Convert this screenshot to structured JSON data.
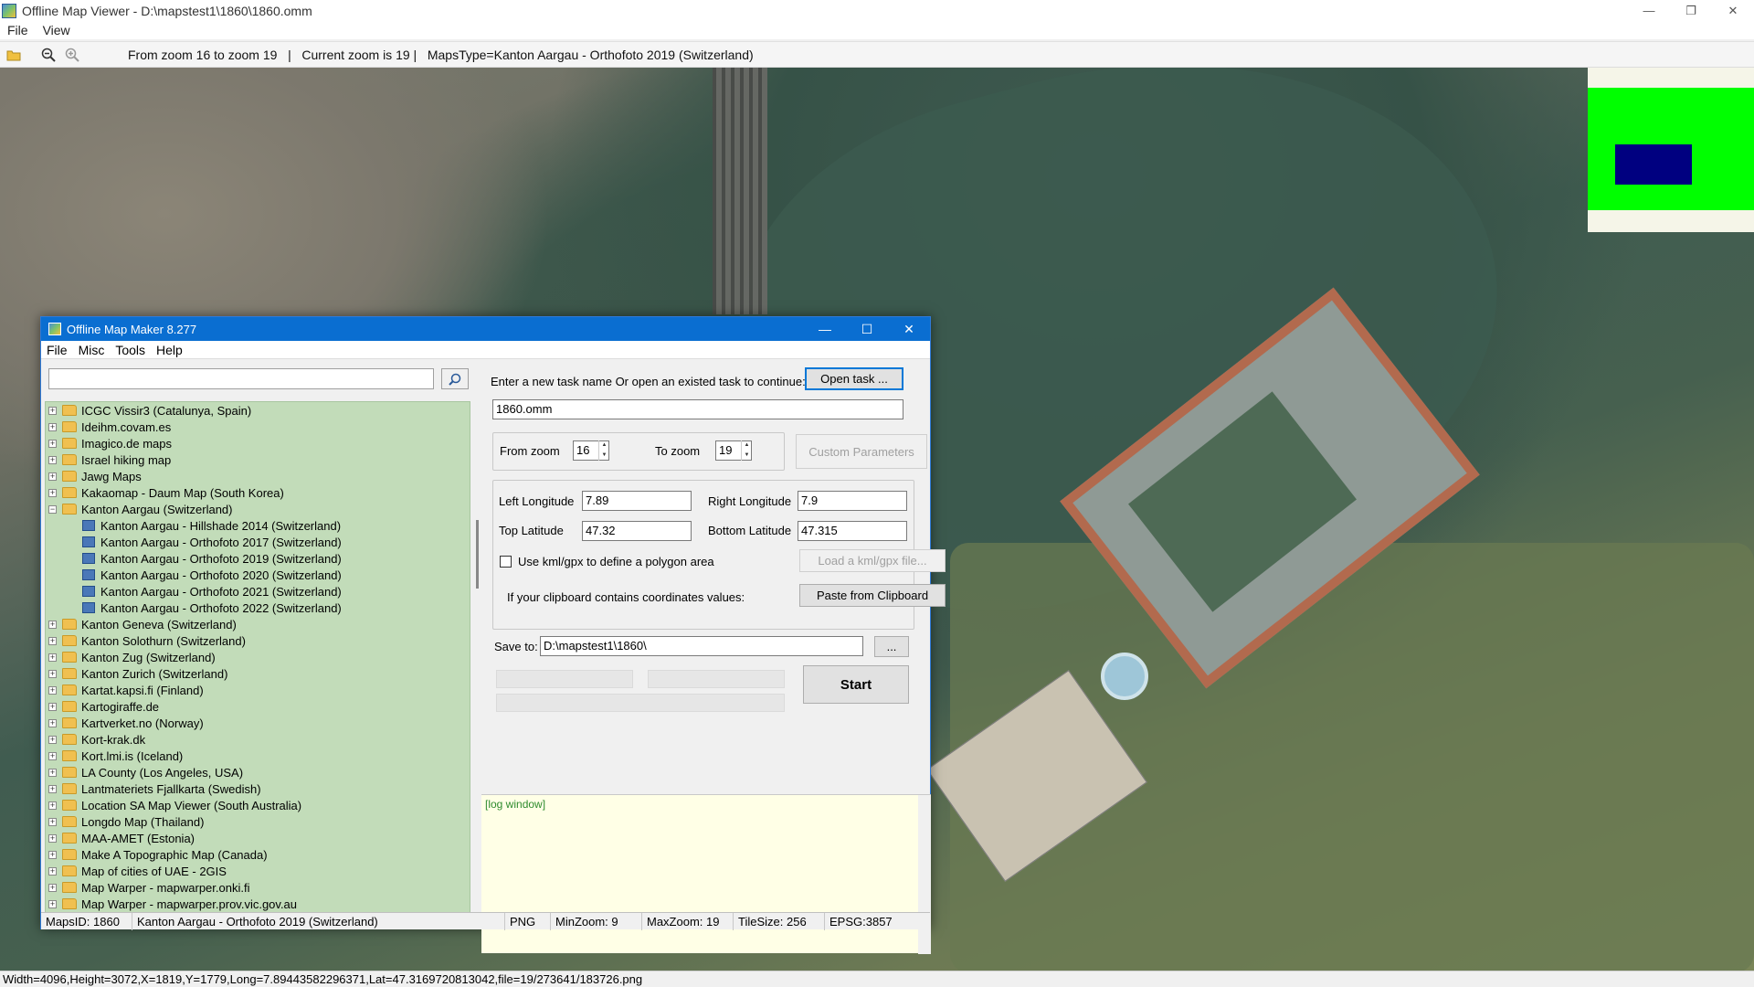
{
  "outer": {
    "title": "Offline Map Viewer - D:\\mapstest1\\1860\\1860.omm",
    "menu": [
      "File",
      "View"
    ],
    "status_info": "From zoom 16 to zoom 19   |   Current zoom is 19 |   MapsType=Kanton Aargau - Orthofoto 2019 (Switzerland)",
    "bottom_status": "Width=4096,Height=3072,X=1819,Y=1779,Long=7.89443582296371,Lat=47.3169720813042,file=19/273641/183726.png"
  },
  "dialog": {
    "title": "Offline Map Maker 8.277",
    "menu": [
      "File",
      "Misc",
      "Tools",
      "Help"
    ],
    "search_value": "",
    "tree": [
      {
        "label": "ICGC Vissir3 (Catalunya, Spain)",
        "type": "folder"
      },
      {
        "label": "Ideihm.covam.es",
        "type": "folder"
      },
      {
        "label": "Imagico.de maps",
        "type": "folder"
      },
      {
        "label": "Israel hiking map",
        "type": "folder"
      },
      {
        "label": "Jawg Maps",
        "type": "folder"
      },
      {
        "label": "Kakaomap - Daum Map (South Korea)",
        "type": "folder"
      },
      {
        "label": "Kanton Aargau (Switzerland)",
        "type": "folder-open"
      },
      {
        "label": "Kanton Aargau - Hillshade 2014 (Switzerland)",
        "type": "map"
      },
      {
        "label": "Kanton Aargau - Orthofoto 2017 (Switzerland)",
        "type": "map"
      },
      {
        "label": "Kanton Aargau - Orthofoto 2019 (Switzerland)",
        "type": "map"
      },
      {
        "label": "Kanton Aargau - Orthofoto 2020 (Switzerland)",
        "type": "map"
      },
      {
        "label": "Kanton Aargau - Orthofoto 2021 (Switzerland)",
        "type": "map"
      },
      {
        "label": "Kanton Aargau - Orthofoto 2022 (Switzerland)",
        "type": "map"
      },
      {
        "label": "Kanton Geneva (Switzerland)",
        "type": "folder"
      },
      {
        "label": "Kanton Solothurn (Switzerland)",
        "type": "folder"
      },
      {
        "label": "Kanton Zug (Switzerland)",
        "type": "folder"
      },
      {
        "label": "Kanton Zurich (Switzerland)",
        "type": "folder"
      },
      {
        "label": "Kartat.kapsi.fi (Finland)",
        "type": "folder"
      },
      {
        "label": "Kartogiraffe.de",
        "type": "folder"
      },
      {
        "label": "Kartverket.no (Norway)",
        "type": "folder"
      },
      {
        "label": "Kort-krak.dk",
        "type": "folder"
      },
      {
        "label": "Kort.lmi.is (Iceland)",
        "type": "folder"
      },
      {
        "label": "LA County (Los Angeles, USA)",
        "type": "folder"
      },
      {
        "label": "Lantmateriets Fjallkarta (Swedish)",
        "type": "folder"
      },
      {
        "label": "Location SA Map Viewer (South Australia)",
        "type": "folder"
      },
      {
        "label": "Longdo Map (Thailand)",
        "type": "folder"
      },
      {
        "label": "MAA-AMET (Estonia)",
        "type": "folder"
      },
      {
        "label": "Make A Topographic Map (Canada)",
        "type": "folder"
      },
      {
        "label": "Map of cities of UAE - 2GIS",
        "type": "folder"
      },
      {
        "label": "Map Warper - mapwarper.onki.fi",
        "type": "folder"
      },
      {
        "label": "Map Warper - mapwarper.prov.vic.gov.au",
        "type": "folder"
      }
    ],
    "task_prompt": "Enter a new task name Or open an existed task to continue:",
    "open_task_label": "Open task ...",
    "task_name": "1860.omm",
    "from_zoom_label": "From zoom",
    "from_zoom": "16",
    "to_zoom_label": "To zoom",
    "to_zoom": "19",
    "custom_params_label": "Custom Parameters",
    "left_lon_label": "Left Longitude",
    "left_lon": "7.89",
    "right_lon_label": "Right Longitude",
    "right_lon": "7.9",
    "top_lat_label": "Top Latitude",
    "top_lat": "47.32",
    "bottom_lat_label": "Bottom Latitude",
    "bottom_lat": "47.315",
    "kml_check_label": "Use kml/gpx to define a polygon area",
    "load_kml_label": "Load a kml/gpx file...",
    "clipboard_prompt": "If your clipboard contains coordinates values:",
    "paste_label": "Paste from Clipboard",
    "save_to_label": "Save to:",
    "save_path": "D:\\mapstest1\\1860\\",
    "browse_label": "...",
    "start_label": "Start",
    "log_text": "[log window]",
    "status": {
      "maps_id": "MapsID: 1860",
      "map_name": "Kanton Aargau - Orthofoto 2019 (Switzerland)",
      "format": "PNG",
      "min_zoom": "MinZoom: 9",
      "max_zoom": "MaxZoom: 19",
      "tile_size": "TileSize: 256",
      "epsg": "EPSG:3857"
    }
  },
  "colors": {
    "dialog_titlebar": "#0a6ed1",
    "tree_background": "#c2dcb9",
    "log_background": "#ffffe6",
    "minimap_green": "#00ff00",
    "minimap_blue": "#000080"
  }
}
